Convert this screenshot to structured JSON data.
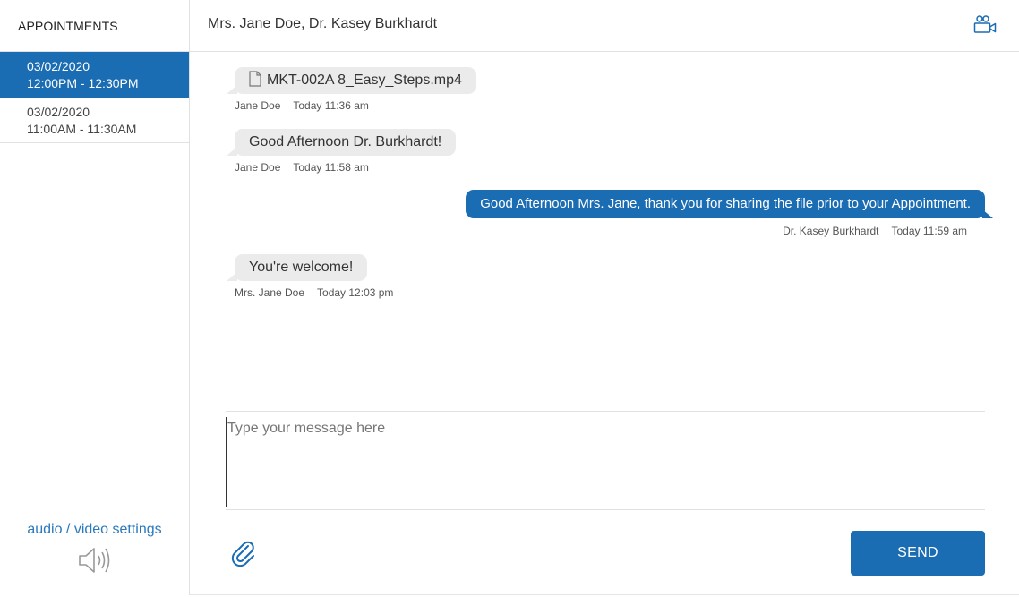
{
  "sidebar": {
    "header": "APPOINTMENTS",
    "appointments": [
      {
        "date": "03/02/2020",
        "time": "12:00PM - 12:30PM",
        "active": true
      },
      {
        "date": "03/02/2020",
        "time": "11:00AM - 11:30AM",
        "active": false
      }
    ],
    "av_settings_label": "audio / video settings",
    "speaker_icon": "speaker-icon"
  },
  "header": {
    "title": "Mrs. Jane Doe, Dr. Kasey Burkhardt",
    "video_icon": "video-call-icon"
  },
  "messages": [
    {
      "direction": "in",
      "text": "MKT-002A 8_Easy_Steps.mp4",
      "is_file": true,
      "sender": "Jane Doe",
      "time": "Today 11:36 am"
    },
    {
      "direction": "in",
      "text": "Good Afternoon Dr. Burkhardt!",
      "is_file": false,
      "sender": "Jane Doe",
      "time": "Today 11:58 am"
    },
    {
      "direction": "out",
      "text": "Good Afternoon Mrs. Jane, thank you for sharing the file prior to your Appointment.",
      "is_file": false,
      "sender": "Dr. Kasey Burkhardt",
      "time": "Today 11:59 am"
    },
    {
      "direction": "in",
      "text": "You're welcome!",
      "is_file": false,
      "sender": "Mrs. Jane Doe",
      "time": "Today 12:03 pm"
    }
  ],
  "composer": {
    "placeholder": "Type your message here",
    "value": "",
    "send_label": "SEND",
    "attach_icon": "paperclip-icon"
  },
  "colors": {
    "accent": "#1a6cb3",
    "link": "#2a79bd",
    "incoming_bubble": "#ebebeb"
  }
}
